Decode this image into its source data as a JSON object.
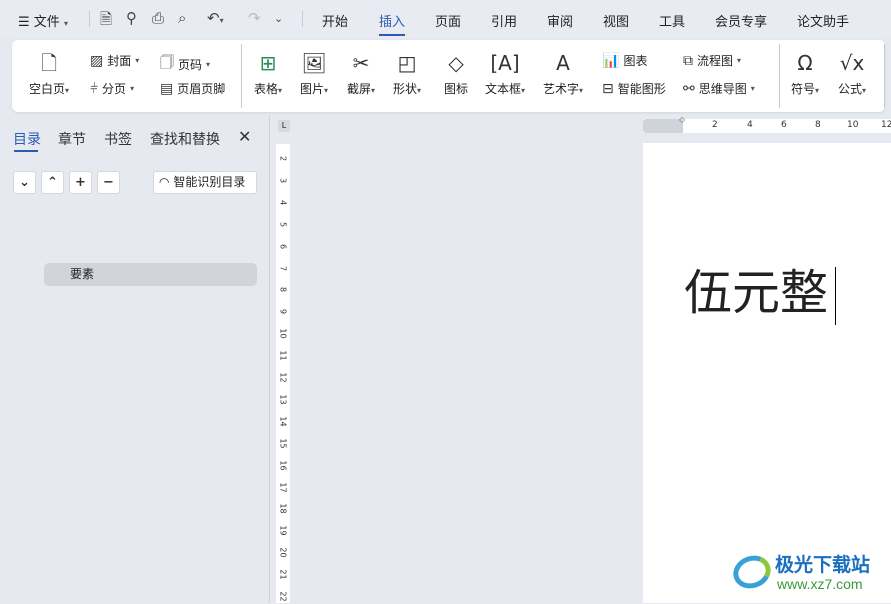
{
  "menubar": {
    "file": "文件",
    "tabs": [
      "开始",
      "插入",
      "页面",
      "引用",
      "审阅",
      "视图",
      "工具",
      "会员专享",
      "论文助手"
    ],
    "active_tab": "插入"
  },
  "ribbon": {
    "blank_page": "空白页",
    "cover": "封面",
    "page_break": "分页",
    "page_number": "页码",
    "header_footer": "页眉页脚",
    "table": "表格",
    "picture": "图片",
    "screenshot": "截屏",
    "shape": "形状",
    "icon": "图标",
    "textbox": "文本框",
    "wordart": "艺术字",
    "chart": "图表",
    "smartart": "智能图形",
    "flowchart": "流程图",
    "mindmap": "思维导图",
    "symbol": "符号",
    "formula": "公式"
  },
  "panel": {
    "tabs": [
      "目录",
      "章节",
      "书签",
      "查找和替换"
    ],
    "smart_toc": "智能识别目录",
    "toc_items": [
      "要素"
    ]
  },
  "ruler": {
    "h": [
      "2",
      "4",
      "6",
      "8",
      "10",
      "12"
    ],
    "v": [
      "2",
      "3",
      "4",
      "5",
      "6",
      "7",
      "8",
      "9",
      "10",
      "11",
      "12",
      "13",
      "14",
      "15",
      "16",
      "17",
      "18",
      "19",
      "20",
      "21",
      "22"
    ]
  },
  "document": {
    "text": "伍元整"
  },
  "watermark": {
    "name": "极光下载站",
    "url": "www.xz7.com"
  },
  "colors": {
    "accent": "#2a5bb5"
  }
}
